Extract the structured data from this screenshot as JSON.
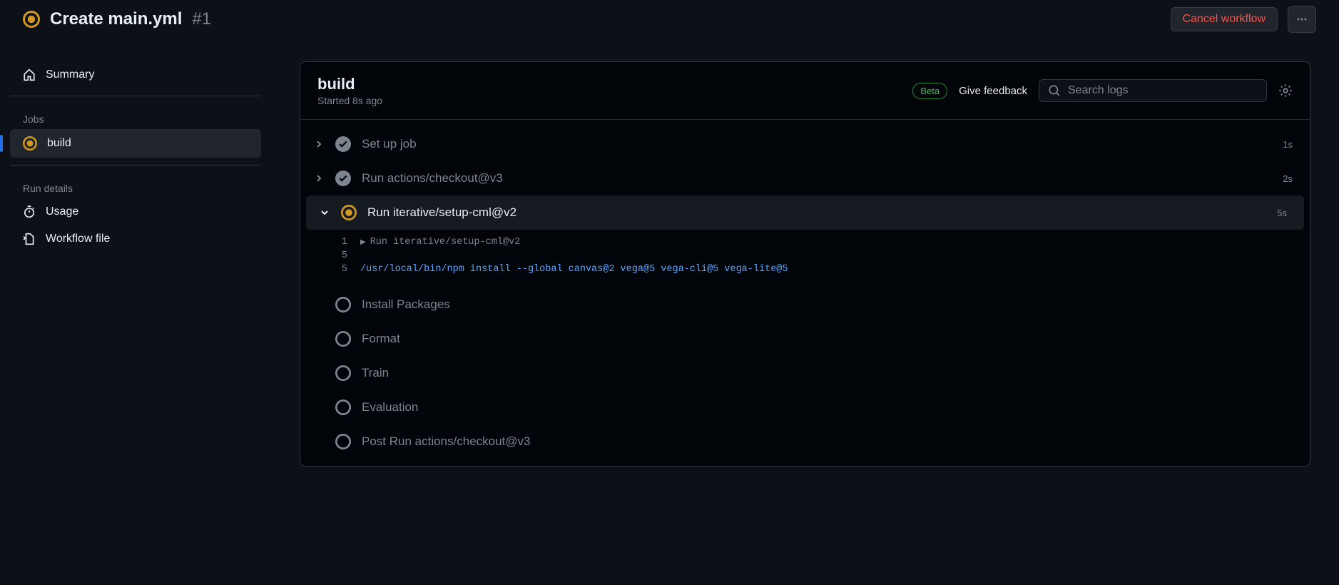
{
  "header": {
    "title": "Create main.yml",
    "run_number": "#1",
    "cancel_label": "Cancel workflow"
  },
  "sidebar": {
    "summary": "Summary",
    "jobs_label": "Jobs",
    "jobs": [
      {
        "label": "build"
      }
    ],
    "run_details_label": "Run details",
    "usage": "Usage",
    "workflow_file": "Workflow file"
  },
  "panel": {
    "title": "build",
    "subtitle": "Started 8s ago",
    "beta": "Beta",
    "feedback": "Give feedback",
    "search_placeholder": "Search logs"
  },
  "steps": [
    {
      "label": "Set up job",
      "status": "success",
      "expanded": false,
      "chevron": "right",
      "time": "1s"
    },
    {
      "label": "Run actions/checkout@v3",
      "status": "success",
      "expanded": false,
      "chevron": "right",
      "time": "2s"
    },
    {
      "label": "Run iterative/setup-cml@v2",
      "status": "running",
      "expanded": true,
      "chevron": "down",
      "time": "5s"
    },
    {
      "label": "Install Packages",
      "status": "pending",
      "expanded": false,
      "chevron": "",
      "time": ""
    },
    {
      "label": "Format",
      "status": "pending",
      "expanded": false,
      "chevron": "",
      "time": ""
    },
    {
      "label": "Train",
      "status": "pending",
      "expanded": false,
      "chevron": "",
      "time": ""
    },
    {
      "label": "Evaluation",
      "status": "pending",
      "expanded": false,
      "chevron": "",
      "time": ""
    },
    {
      "label": "Post Run actions/checkout@v3",
      "status": "pending",
      "expanded": false,
      "chevron": "",
      "time": ""
    }
  ],
  "log": {
    "lines": [
      {
        "num": "1",
        "text": "Run iterative/setup-cml@v2",
        "collapsible": true,
        "cmd": false
      },
      {
        "num": "5",
        "text": "",
        "collapsible": false,
        "cmd": false
      },
      {
        "num": "5",
        "text": "/usr/local/bin/npm install --global canvas@2 vega@5 vega-cli@5 vega-lite@5",
        "collapsible": false,
        "cmd": true
      }
    ]
  }
}
